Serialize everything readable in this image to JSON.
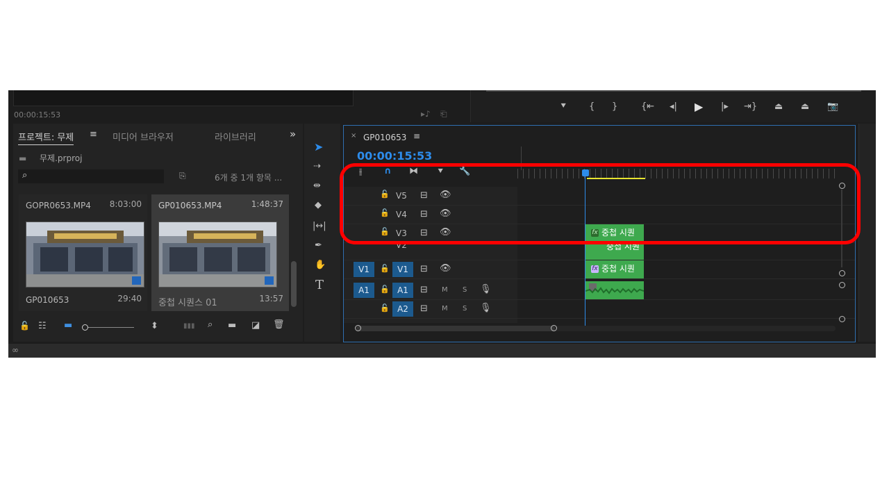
{
  "program_monitor": {
    "timecode": "00:00:15:53",
    "transport_icons": [
      "add-marker",
      "mark-in",
      "mark-out",
      "go-to-in",
      "step-back",
      "play",
      "step-forward",
      "go-to-out",
      "lift",
      "extract",
      "export-frame"
    ]
  },
  "project_panel": {
    "tabs": [
      "프로젝트: 무제",
      "미디어 브라우저",
      "라이브러리"
    ],
    "menu_glyph": "≡",
    "overflow_glyph": "»",
    "project_file": "무제.prproj",
    "search_placeholder": "",
    "item_count": "6개 중 1개 항목 ...",
    "items": [
      {
        "name": "GOPR0653.MP4",
        "duration": "8:03:00"
      },
      {
        "name": "GP010653.MP4",
        "duration": "1:48:37"
      },
      {
        "name": "GP010653",
        "duration": "29:40"
      },
      {
        "name": "중첩 시퀀스 01",
        "duration": "13:57"
      }
    ]
  },
  "timeline": {
    "sequence_name": "GP010653",
    "close_glyph": "×",
    "menu_glyph": "≡",
    "timecode": "00:00:15:53",
    "accent_color": "#2d8ceb",
    "video_tracks": [
      {
        "label": "V5",
        "source": ""
      },
      {
        "label": "V4",
        "source": ""
      },
      {
        "label": "V3",
        "source": ""
      },
      {
        "label": "V2",
        "source": ""
      },
      {
        "label": "V1",
        "source": "V1"
      }
    ],
    "audio_tracks": [
      {
        "label": "A1",
        "source": "A1",
        "m": "M",
        "s": "S"
      },
      {
        "label": "A2",
        "source": "",
        "m": "M",
        "s": "S"
      }
    ],
    "clip_label": "중첩 시퀀",
    "fx": "fx",
    "clip_color": "#3ea94e"
  },
  "annotation": {
    "color": "#ff0000"
  }
}
